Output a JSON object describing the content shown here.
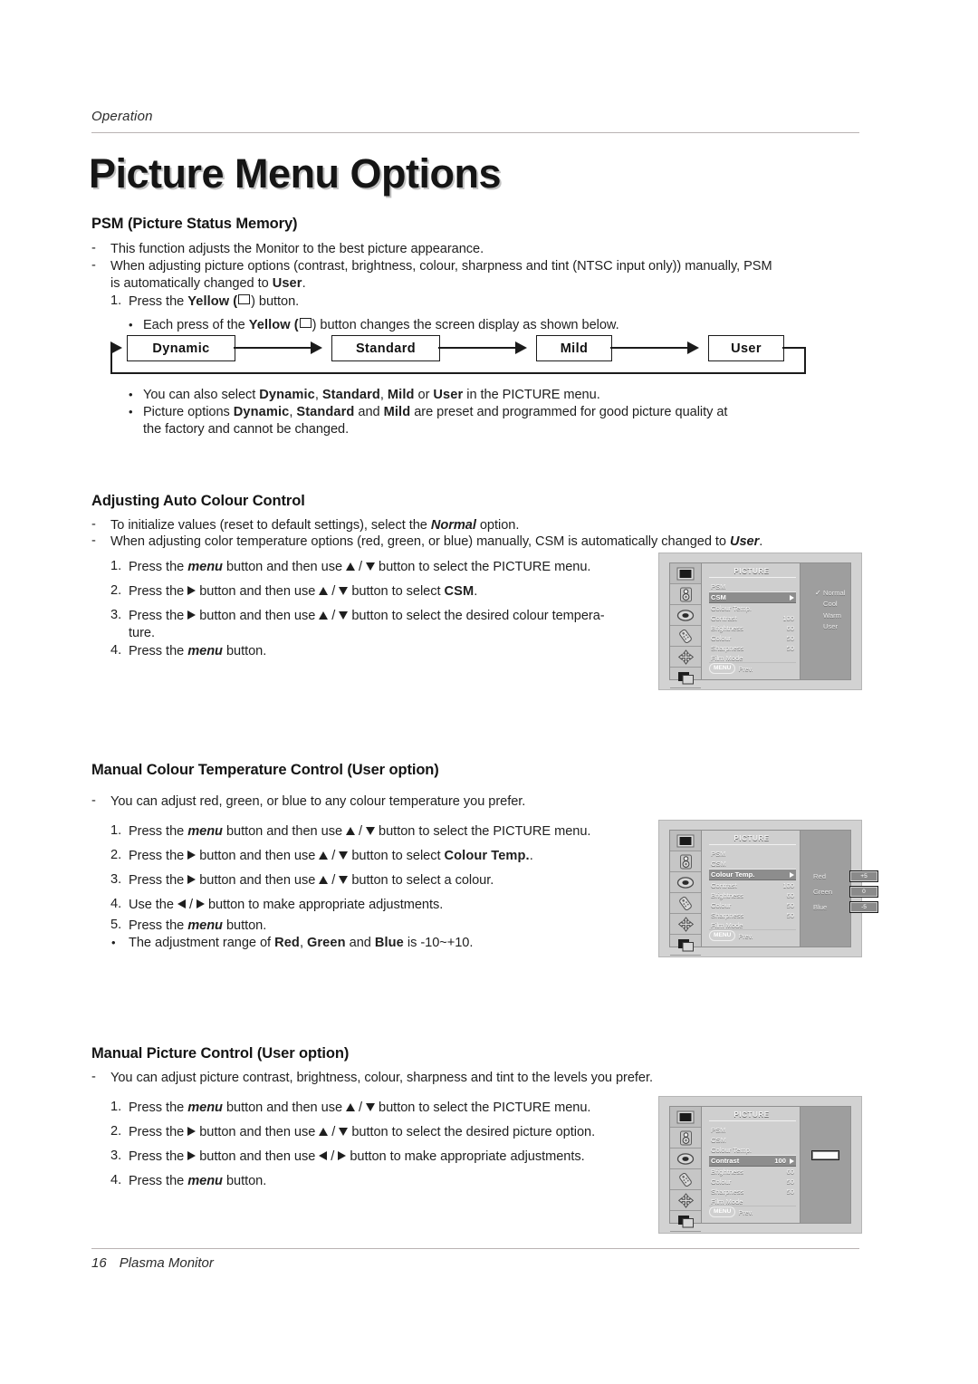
{
  "header": {
    "running_head": "Operation"
  },
  "title": "Picture Menu Options",
  "footer": {
    "page_number": "16",
    "product": "Plasma Monitor"
  },
  "sections": {
    "psm": {
      "heading": "PSM (Picture Status Memory)",
      "bullet1": "This function adjusts the Monitor to the best picture appearance.",
      "bullet2_a": "When adjusting picture options (contrast, brightness, colour, sharpness and tint (NTSC input only)) manually, PSM",
      "bullet2_b_pre": "is automatically changed to ",
      "bullet2_b_bold": "User",
      "bullet2_b_post": ".",
      "step1_pre": "Press the ",
      "step1_bold": "Yellow",
      "step1_mid": " (",
      "step1_post": ") button.",
      "step1_num": "1.",
      "sub1_pre": "Each press of the ",
      "sub1_bold": "Yellow",
      "sub1_mid": " (",
      "sub1_post": ") button changes the screen display as shown below.",
      "flow": {
        "boxes": [
          "Dynamic",
          "Standard",
          "Mild",
          "User"
        ]
      },
      "sub2_pre": "You can also select ",
      "sub2_b1": "Dynamic",
      "sub2_s1": ", ",
      "sub2_b2": "Standard",
      "sub2_s2": ", ",
      "sub2_b3": "Mild",
      "sub2_s3": " or ",
      "sub2_b4": "User",
      "sub2_post": " in the PICTURE menu.",
      "sub3_pre": "Picture options ",
      "sub3_b1": "Dynamic",
      "sub3_s1": ", ",
      "sub3_b2": "Standard",
      "sub3_s2": " and ",
      "sub3_b3": "Mild",
      "sub3_post": " are preset and programmed for good picture quality at",
      "sub3_line2": "the factory and cannot be changed."
    },
    "auto_colour": {
      "heading": "Adjusting Auto Colour Control",
      "bullet1_pre": "To initialize values (reset to default settings), select the ",
      "bullet1_bi": "Normal",
      "bullet1_post": " option.",
      "bullet2_pre": "When adjusting color temperature options (red, green, or blue) manually, CSM is automatically changed to ",
      "bullet2_bi": "User",
      "bullet2_post": ".",
      "steps": [
        {
          "n": "1.",
          "pre": "Press the ",
          "bi": "menu",
          "mid": " button and then use ",
          "post": " button to select the PICTURE menu.",
          "icons": "ud"
        },
        {
          "n": "2.",
          "pre": "Press the ",
          "mid": " button and then use ",
          "post": " button to select ",
          "bold_tail": "CSM",
          "tail2": ".",
          "icons": "r-ud"
        },
        {
          "n": "3.",
          "pre": "Press the ",
          "mid": " button and then use ",
          "post": " button to select the desired colour tempera-",
          "icons": "r-ud",
          "line2": "ture."
        },
        {
          "n": "4.",
          "pre": "Press the ",
          "bi": "menu",
          "post": " button."
        }
      ]
    },
    "manual_colour_temp": {
      "heading": "Manual Colour Temperature Control (User option)",
      "bullet1": "You can adjust red, green, or blue to any colour temperature you prefer.",
      "steps": [
        {
          "n": "1.",
          "pre": "Press the ",
          "bi": "menu",
          "mid": " button and then use ",
          "post": " button to select the PICTURE menu."
        },
        {
          "n": "2.",
          "pre": "Press the ",
          "mid": " button and then use ",
          "post": " button to select ",
          "bold_tail": "Colour Temp.",
          "tail2": "."
        },
        {
          "n": "3.",
          "pre": "Press the ",
          "mid": " button and then use ",
          "post": " button to select a colour."
        },
        {
          "n": "4.",
          "pre": "Use the ",
          "mid": " / ",
          "post": " button to make appropriate adjustments."
        },
        {
          "n": "5.",
          "pre": "Press the ",
          "bi": "menu",
          "post": " button."
        }
      ],
      "note_pre": "The adjustment range of ",
      "note_b1": "Red",
      "note_s1": ", ",
      "note_b2": "Green",
      "note_s2": " and ",
      "note_b3": "Blue",
      "note_post": " is -10~+10."
    },
    "manual_picture": {
      "heading": "Manual Picture Control (User option)",
      "bullet1": "You can adjust picture contrast, brightness, colour, sharpness and tint to the levels you prefer.",
      "steps": [
        {
          "n": "1.",
          "pre": "Press the ",
          "bi": "menu",
          "mid": " button and then use ",
          "post": " button to select the PICTURE menu."
        },
        {
          "n": "2.",
          "pre": "Press the ",
          "mid": " button and then use ",
          "post": " button to select the desired picture option."
        },
        {
          "n": "3.",
          "pre": "Press the ",
          "mid": " button and then use ",
          "post": " button to make appropriate adjustments."
        },
        {
          "n": "4.",
          "pre": "Press the ",
          "bi": "menu",
          "post": " button."
        }
      ]
    }
  },
  "osd": {
    "menu_title": "PICTURE",
    "footer_menu": "MENU",
    "footer_prev": "Prev.",
    "rail_icons": [
      "screen-icon",
      "speaker-icon",
      "clock-icon",
      "remote-icon",
      "position-icon",
      "pip-icon"
    ],
    "rows": [
      {
        "label": "PSM",
        "value": ""
      },
      {
        "label": "CSM",
        "value": ""
      },
      {
        "label": "Colour Temp.",
        "value": ""
      },
      {
        "label": "Contrast",
        "value": "100"
      },
      {
        "label": "Brightness",
        "value": "60"
      },
      {
        "label": "Colour",
        "value": "50"
      },
      {
        "label": "Sharpness",
        "value": "50"
      },
      {
        "label": "Film Mode",
        "value": ""
      }
    ],
    "screen1": {
      "highlight_row": "CSM",
      "options": [
        {
          "label": "Normal",
          "checked": "✓"
        },
        {
          "label": "Cool",
          "checked": ""
        },
        {
          "label": "Warm",
          "checked": ""
        },
        {
          "label": "User",
          "checked": ""
        }
      ]
    },
    "screen2": {
      "highlight_row": "Colour Temp.",
      "rgb": [
        {
          "name": "Red",
          "value": "+5"
        },
        {
          "name": "Green",
          "value": "0"
        },
        {
          "name": "Blue",
          "value": "-5"
        }
      ]
    },
    "screen3": {
      "highlight_row": "Contrast",
      "highlight_value": "100",
      "slider_percent": 100
    }
  }
}
